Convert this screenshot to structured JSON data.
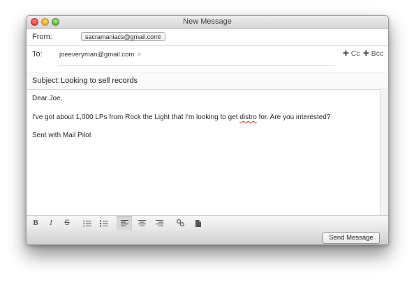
{
  "window": {
    "title": "New Message"
  },
  "header": {
    "from_label": "From:",
    "from_value": "sacramaniacs@gmail.com",
    "to_label": "To:",
    "to_recipient": "joeeveryman@gmail.com",
    "to_remove_glyph": "×",
    "cc_label": "Cc",
    "bcc_label": "Bcc",
    "subject_label": "Subject:",
    "subject_value": "Looking to sell records"
  },
  "body": {
    "lines": [
      "Dear Joe,",
      "I've got about 1,000 LPs from Rock the Light that I'm looking to get",
      "distro",
      "for. Are you interested?",
      "Sent with Mail Pilot"
    ]
  },
  "toolbar": {
    "items": [
      {
        "name": "bold-button",
        "icon": "bold-icon"
      },
      {
        "name": "italic-button",
        "icon": "italic-icon"
      },
      {
        "name": "strikethrough-button",
        "icon": "strikethrough-icon"
      },
      {
        "name": "bullet-list-button",
        "icon": "bullet-list-icon"
      },
      {
        "name": "numbered-list-button",
        "icon": "numbered-list-icon"
      },
      {
        "name": "align-left-button",
        "icon": "align-left-icon"
      },
      {
        "name": "align-center-button",
        "icon": "align-center-icon"
      },
      {
        "name": "align-right-button",
        "icon": "align-right-icon"
      },
      {
        "name": "link-button",
        "icon": "link-icon"
      },
      {
        "name": "attach-button",
        "icon": "document-icon"
      }
    ],
    "bold_glyph": "B",
    "italic_glyph": "I",
    "strike_glyph": "S"
  },
  "footer": {
    "send_label": "Send Message"
  },
  "colors": {
    "close": "#e0443e",
    "minimize": "#e9a51f",
    "maximize": "#5fae35",
    "spellcheck": "#d0302a"
  }
}
